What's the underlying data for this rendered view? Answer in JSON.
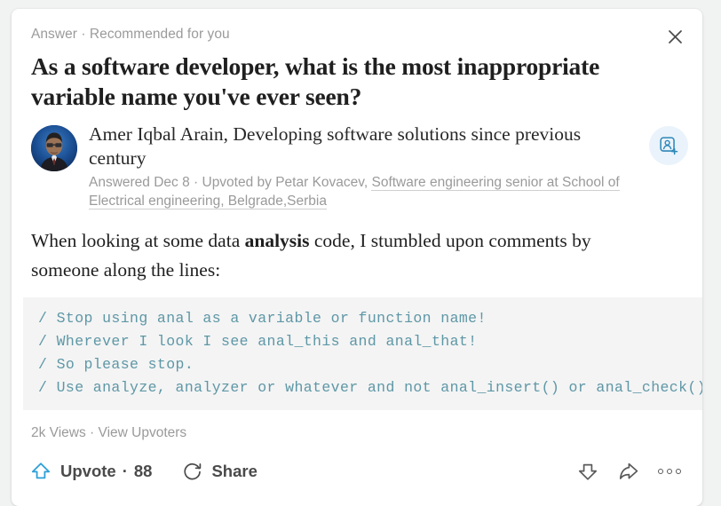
{
  "header": {
    "kicker": "Answer · Recommended for you",
    "close_icon": "close-icon",
    "question_title": "As a software developer, what is the most inappropriate variable name you've ever seen?"
  },
  "author": {
    "avatar_alt": "author-avatar",
    "name": "Amer Iqbal Arain",
    "separator": ", ",
    "headline": "Developing software solutions since previous century",
    "byline_prefix": "Answered Dec 8 · Upvoted by Petar Kovacev, ",
    "credential_link": "Software engineering senior at School of Electrical engineering, Belgrade,Serbia",
    "follow_icon": "add-person-icon",
    "follow_icon_bg": "#eaf3fb",
    "follow_icon_color": "#2e87b8"
  },
  "body": {
    "paragraph_part1": "When looking at some data ",
    "paragraph_bold": "analysis",
    "paragraph_part2": " code, I stumbled upon comments by someone along the lines:",
    "code_color": "#5e97a6",
    "code_bg": "#f4f4f4",
    "code_lines": [
      "/ Stop using anal as a variable or function name!",
      "/ Wherever I look I see anal_this and anal_that!",
      "/ So please stop.",
      "/ Use analyze, analyzer or whatever and not anal_insert() or anal_check()"
    ]
  },
  "footer": {
    "views": "2k Views",
    "views_separator": " · ",
    "view_upvoters": "View Upvoters",
    "upvote_label": "Upvote",
    "upvote_dot": "·",
    "upvote_count": "88",
    "share_label": "Share",
    "upvote_icon": "upvote-arrow-icon",
    "upvote_icon_color": "#2e9fd8",
    "share_icon": "share-circular-arrow-icon",
    "downvote_icon": "downvote-arrow-icon",
    "forward_icon": "forward-arrow-icon",
    "more_icon": "more-horizontal-icon"
  }
}
